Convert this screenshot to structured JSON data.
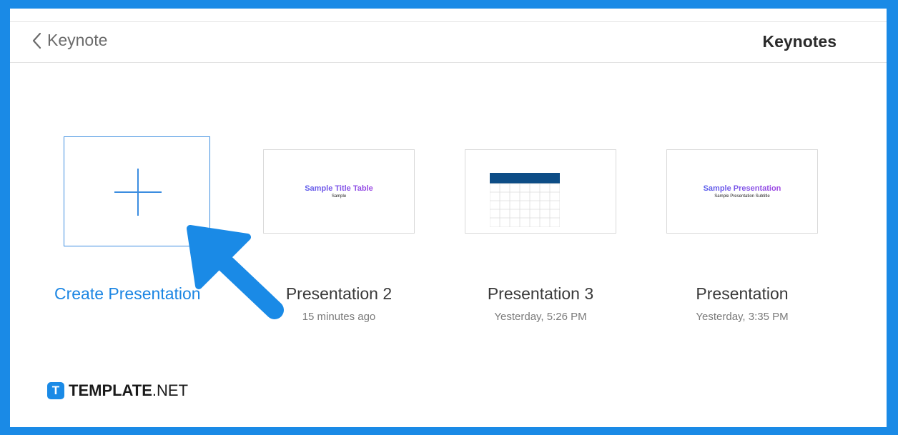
{
  "header": {
    "back_label": "Keynote",
    "title": "Keynotes"
  },
  "create": {
    "label": "Create Presentation"
  },
  "presentations": [
    {
      "name": "Presentation 2",
      "date": "15 minutes ago",
      "thumb_title": "Sample Title Table",
      "thumb_subtitle": "Sample"
    },
    {
      "name": "Presentation 3",
      "date": "Yesterday, 5:26 PM"
    },
    {
      "name": "Presentation",
      "date": "Yesterday, 3:35 PM",
      "thumb_title": "Sample Presentation",
      "thumb_subtitle": "Sample Presentation Subtitle"
    }
  ],
  "brand": {
    "mark": "T",
    "bold": "TEMPLATE",
    "suffix": ".NET"
  },
  "colors": {
    "accent": "#1a8ae6",
    "link": "#1c86e3",
    "table_header": "#0d4d86"
  }
}
